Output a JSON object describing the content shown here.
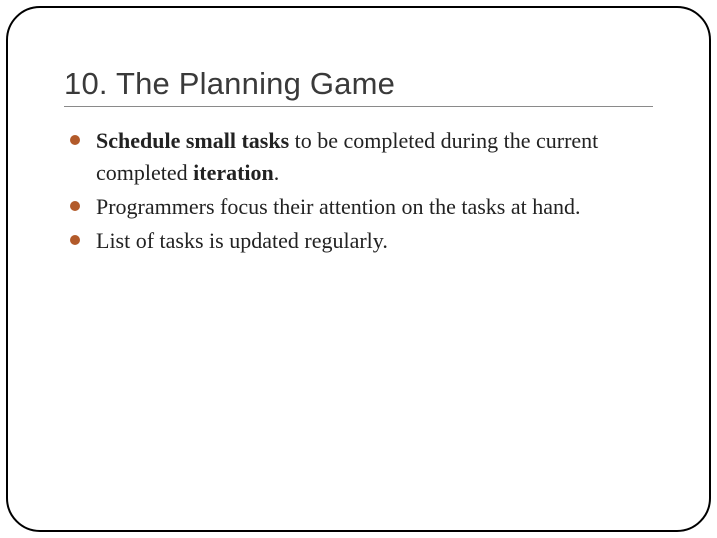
{
  "slide": {
    "title": "10. The Planning Game",
    "bullets": [
      {
        "segments": [
          {
            "text": "Schedule small tasks",
            "bold": true
          },
          {
            "text": " to be completed during the current completed ",
            "bold": false
          },
          {
            "text": "iteration",
            "bold": true
          },
          {
            "text": ".",
            "bold": false
          }
        ]
      },
      {
        "segments": [
          {
            "text": "Programmers focus their attention on the tasks at hand.",
            "bold": false
          }
        ]
      },
      {
        "segments": [
          {
            "text": "List of tasks is updated regularly.",
            "bold": false
          }
        ]
      }
    ]
  }
}
